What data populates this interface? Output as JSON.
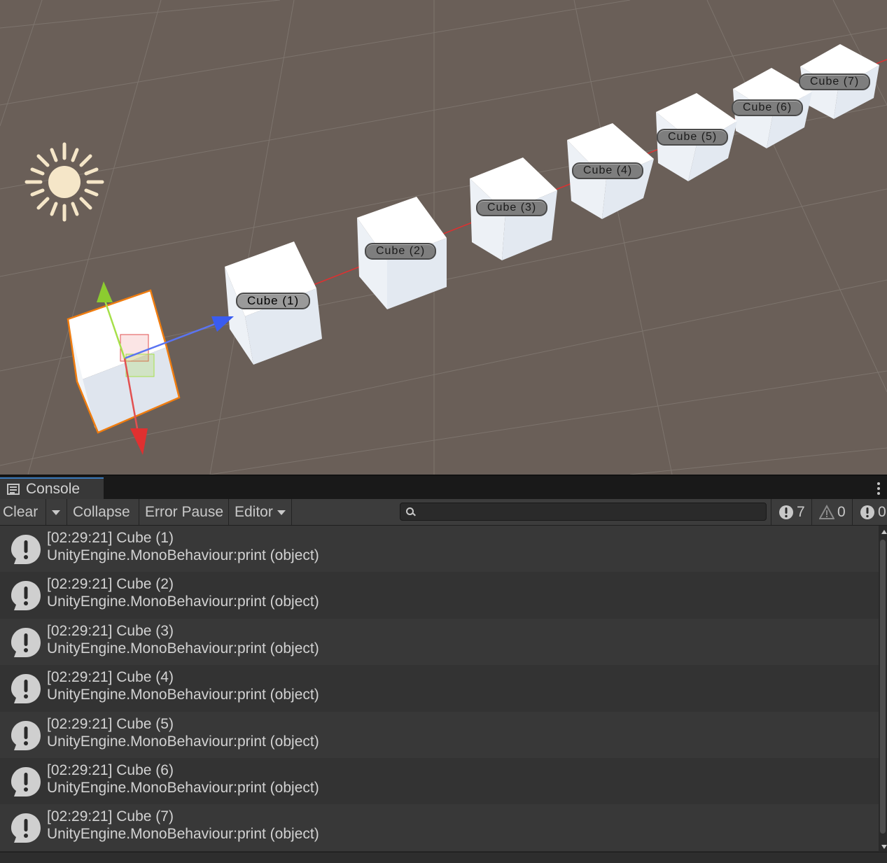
{
  "scene": {
    "cube_labels": [
      "Cube (1)",
      "Cube (2)",
      "Cube (3)",
      "Cube (4)",
      "Cube (5)",
      "Cube (6)",
      "Cube (7)"
    ],
    "colors": {
      "background": "#6a5f58",
      "grid": "#7d746d",
      "axis_red": "#e03030",
      "axis_blue": "#3a5cf0",
      "axis_green": "#8ccc30",
      "selection": "#f07d10",
      "sun": "#f5e6c8"
    }
  },
  "console": {
    "tab_label": "Console",
    "toolbar": {
      "clear": "Clear",
      "collapse": "Collapse",
      "error_pause": "Error Pause",
      "editor": "Editor",
      "search_placeholder": ""
    },
    "counts": {
      "info": "7",
      "warning": "0",
      "error": "0"
    },
    "entries": [
      {
        "line1": "[02:29:21] Cube (1)",
        "line2": "UnityEngine.MonoBehaviour:print (object)"
      },
      {
        "line1": "[02:29:21] Cube (2)",
        "line2": "UnityEngine.MonoBehaviour:print (object)"
      },
      {
        "line1": "[02:29:21] Cube (3)",
        "line2": "UnityEngine.MonoBehaviour:print (object)"
      },
      {
        "line1": "[02:29:21] Cube (4)",
        "line2": "UnityEngine.MonoBehaviour:print (object)"
      },
      {
        "line1": "[02:29:21] Cube (5)",
        "line2": "UnityEngine.MonoBehaviour:print (object)"
      },
      {
        "line1": "[02:29:21] Cube (6)",
        "line2": "UnityEngine.MonoBehaviour:print (object)"
      },
      {
        "line1": "[02:29:21] Cube (7)",
        "line2": "UnityEngine.MonoBehaviour:print (object)"
      }
    ]
  }
}
